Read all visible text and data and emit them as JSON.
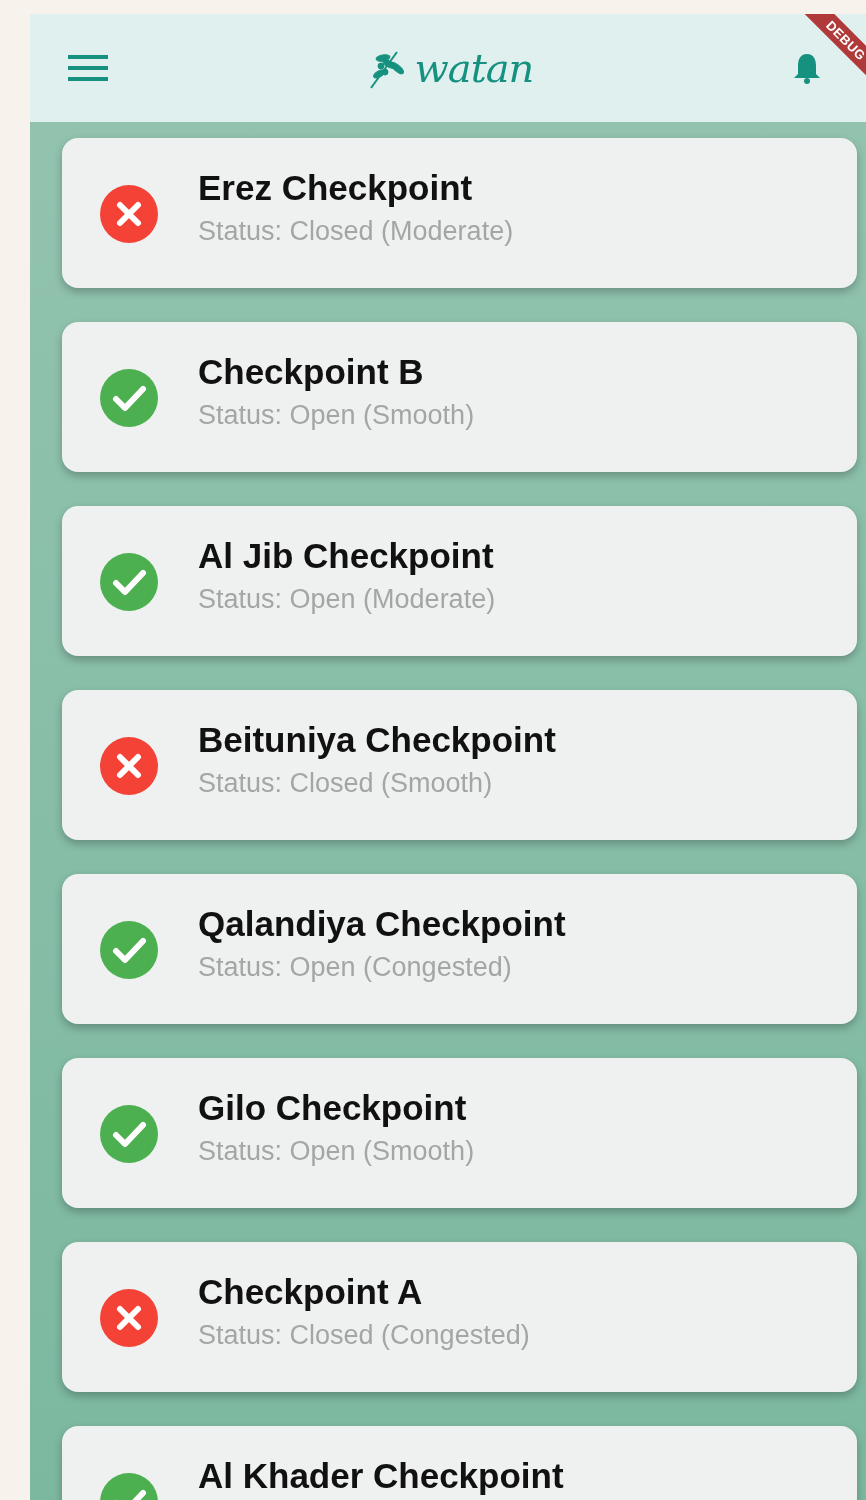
{
  "app_bar": {
    "logo": "watan",
    "debug_banner": "DEBUG"
  },
  "checkpoints": [
    {
      "name": "Erez Checkpoint",
      "status": "Status: Closed (Moderate)",
      "open": false
    },
    {
      "name": "Checkpoint B",
      "status": "Status: Open (Smooth)",
      "open": true
    },
    {
      "name": "Al Jib Checkpoint",
      "status": "Status: Open (Moderate)",
      "open": true
    },
    {
      "name": "Beituniya Checkpoint",
      "status": "Status: Closed (Smooth)",
      "open": false
    },
    {
      "name": "Qalandiya Checkpoint",
      "status": "Status: Open (Congested)",
      "open": true
    },
    {
      "name": "Gilo Checkpoint",
      "status": "Status: Open (Smooth)",
      "open": true
    },
    {
      "name": "Checkpoint A",
      "status": "Status: Closed (Congested)",
      "open": false
    },
    {
      "name": "Al Khader Checkpoint",
      "open": true
    }
  ]
}
